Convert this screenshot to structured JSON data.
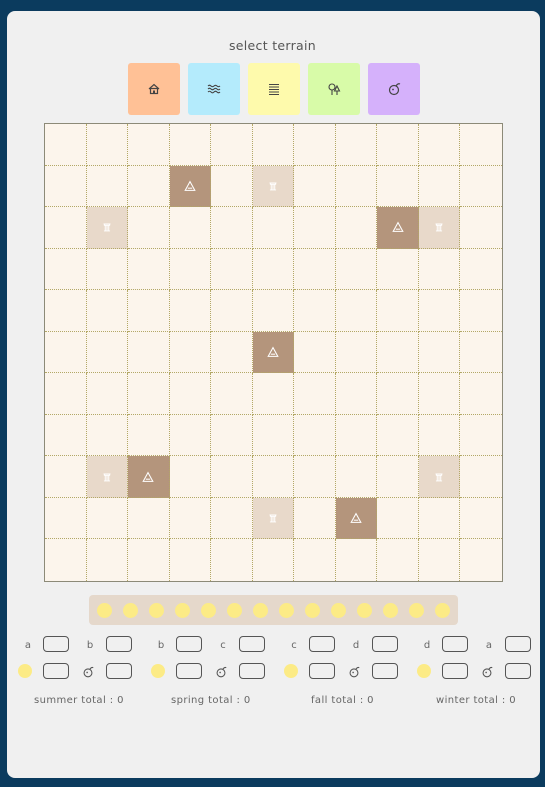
{
  "header": {
    "title": "select terrain"
  },
  "palette": [
    {
      "name": "village",
      "icon": "house-icon",
      "color": "#ffc196"
    },
    {
      "name": "water",
      "icon": "waves-icon",
      "color": "#b4ebfc"
    },
    {
      "name": "farm",
      "icon": "field-icon",
      "color": "#fefaac"
    },
    {
      "name": "forest",
      "icon": "trees-icon",
      "color": "#d8fba8"
    },
    {
      "name": "monster",
      "icon": "monster-icon",
      "color": "#d5b1fb"
    }
  ],
  "board": {
    "size": 11,
    "colors": {
      "empty": "#fcf5ec",
      "mountain": "#b4957c",
      "ruin": "#e8d9ca"
    },
    "cells": [
      {
        "row": 1,
        "col": 3,
        "type": "mountain",
        "icon": "mountain-icon"
      },
      {
        "row": 1,
        "col": 5,
        "type": "ruin",
        "icon": "ruin-icon"
      },
      {
        "row": 2,
        "col": 1,
        "type": "ruin",
        "icon": "ruin-icon"
      },
      {
        "row": 2,
        "col": 8,
        "type": "mountain",
        "icon": "mountain-icon"
      },
      {
        "row": 2,
        "col": 9,
        "type": "ruin",
        "icon": "ruin-icon"
      },
      {
        "row": 5,
        "col": 5,
        "type": "mountain",
        "icon": "mountain-icon"
      },
      {
        "row": 8,
        "col": 1,
        "type": "ruin",
        "icon": "ruin-icon"
      },
      {
        "row": 8,
        "col": 2,
        "type": "mountain",
        "icon": "mountain-icon"
      },
      {
        "row": 8,
        "col": 9,
        "type": "ruin",
        "icon": "ruin-icon"
      },
      {
        "row": 9,
        "col": 5,
        "type": "ruin",
        "icon": "ruin-icon"
      },
      {
        "row": 9,
        "col": 7,
        "type": "mountain",
        "icon": "mountain-icon"
      }
    ]
  },
  "coins": {
    "count": 14,
    "color": "#fceb86"
  },
  "seasons": [
    {
      "name": "summer",
      "goal_a": "a",
      "goal_b": "b",
      "total_label": "summer total : 0"
    },
    {
      "name": "spring",
      "goal_a": "b",
      "goal_b": "c",
      "total_label": "spring total : 0"
    },
    {
      "name": "fall",
      "goal_a": "c",
      "goal_b": "d",
      "total_label": "fall total : 0"
    },
    {
      "name": "winter",
      "goal_a": "d",
      "goal_b": "a",
      "total_label": "winter total : 0"
    }
  ]
}
